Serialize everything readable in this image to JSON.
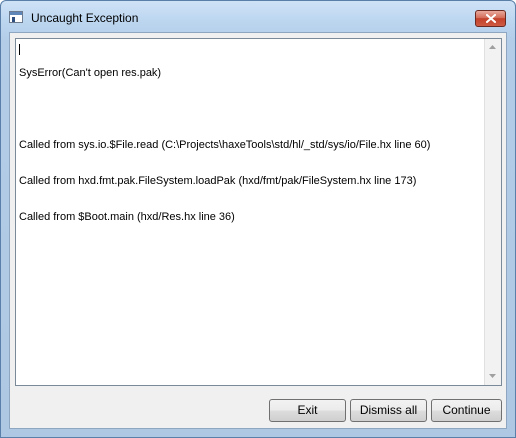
{
  "window": {
    "title": "Uncaught Exception",
    "title_icon": "window-app-icon",
    "close_icon": "close-icon"
  },
  "error_text": {
    "lines": [
      "SysError(Can't open res.pak)",
      "",
      "Called from sys.io.$File.read (C:\\Projects\\haxeTools\\std/hl/_std/sys/io/File.hx line 60)",
      "Called from hxd.fmt.pak.FileSystem.loadPak (hxd/fmt/pak/FileSystem.hx line 173)",
      "Called from $Boot.main (hxd/Res.hx line 36)"
    ]
  },
  "scrollbar": {
    "up_icon": "scroll-up-arrow-icon",
    "down_icon": "scroll-down-arrow-icon"
  },
  "buttons": {
    "exit_label": "Exit",
    "dismiss_all_label": "Dismiss all",
    "continue_label": "Continue"
  },
  "colors": {
    "title_bar": "#bcd6f0",
    "close_button": "#c2412a",
    "dialog_background": "#f0f0f0"
  }
}
